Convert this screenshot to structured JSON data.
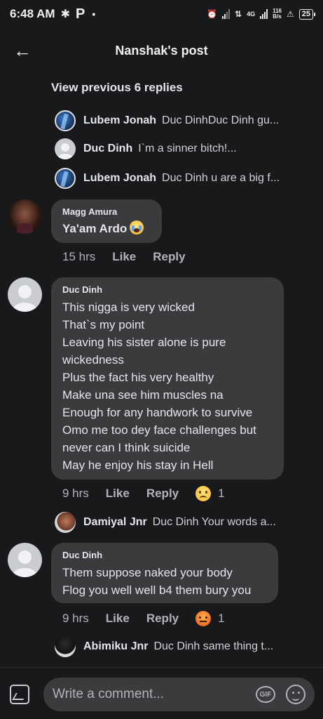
{
  "status_bar": {
    "time": "6:48 AM",
    "p_icon": "P",
    "dot": "•",
    "network_type": "4G",
    "speed_value": "116",
    "speed_unit": "B/s",
    "battery": "25"
  },
  "header": {
    "title": "Nanshak's post",
    "back_icon": "←"
  },
  "view_previous": "View previous 6 replies",
  "reply_previews": [
    {
      "name": "Lubem Jonah",
      "text": "Duc DinhDuc Dinh gu..."
    },
    {
      "name": "Duc Dinh",
      "text": "I`m a sinner bitch!..."
    },
    {
      "name": "Lubem Jonah",
      "text": "Duc Dinh u are a big f..."
    }
  ],
  "comments": [
    {
      "author": "Magg Amura",
      "text": "Ya'am Ardo",
      "time": "15 hrs",
      "like": "Like",
      "reply": "Reply"
    },
    {
      "author": "Duc Dinh",
      "text": "This nigga is very wicked\nThat`s my point\nLeaving his sister alone is pure\nwickedness\nPlus the fact his very healthy\nMake una see him muscles na\nEnough for any handwork to survive\nOmo me too dey face challenges but\nnever can I think suicide\nMay he enjoy his stay in Hell",
      "time": "9 hrs",
      "like": "Like",
      "reply": "Reply",
      "reaction_count": "1"
    },
    {
      "author": "Duc Dinh",
      "text": "Them suppose naked your body\nFlog you well well b4 them bury you",
      "time": "9 hrs",
      "like": "Like",
      "reply": "Reply",
      "reaction_count": "1"
    }
  ],
  "sub_replies": [
    {
      "name": "Damiyal Jnr",
      "text": "Duc Dinh Your words a..."
    },
    {
      "name": "Abimiku Jnr",
      "text": "Duc Dinh same thing t..."
    }
  ],
  "composer": {
    "placeholder": "Write a comment...",
    "gif_label": "GIF"
  }
}
